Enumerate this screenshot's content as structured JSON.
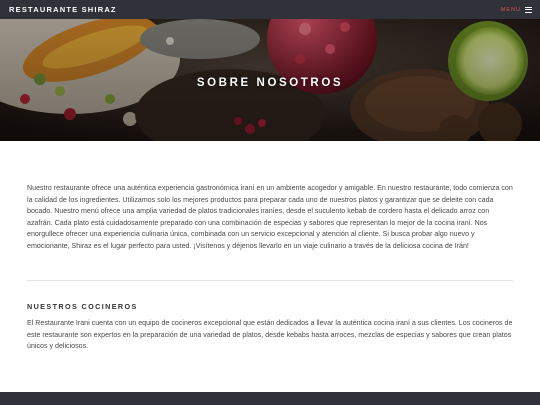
{
  "header": {
    "brand": "RESTAURANTE SHIRAZ",
    "menu_label": "MENU"
  },
  "hero": {
    "title": "SOBRE NOSOTROS"
  },
  "about": {
    "paragraph": "Nuestro restaurante ofrece una auténtica experiencia gastronómica iraní en un ambiente acogedor y amigable. En nuestro restaurante, todo comienza con la calidad de los ingredientes. Utilizamos solo los mejores productos para preparar cada uno de nuestros platos y garantizar que se deleite con cada bocado. Nuestro menú ofrece una amplia variedad de platos tradicionales iraníes, desde el suculento kebab de cordero hasta el delicado arroz con azafrán. Cada plato está cuidadosamente preparado con una combinación de especias y sabores que representan lo mejor de la cocina iraní. Nos enorgullece ofrecer una experiencia culinaria única, combinada con un servicio excepcional y atención al cliente. Si busca probar algo nuevo y emocionante, Shiraz es el lugar perfecto para usted. ¡Visítenos y déjenos llevarlo en un viaje culinario a través de la deliciosa cocina de Irán!"
  },
  "chefs": {
    "title": "NUESTROS COCINEROS",
    "paragraph": "El Restaurante Irani cuenta con un equipo de cocineros excepcional que están dedicados a llevar la auténtica cocina iraní a sus clientes. Los cocineros de este restaurante son expertos en la preparación de una variedad de platos, desde kebabs hasta arroces, mezclas de especias y sabores que crean platos únicos y deliciosos."
  },
  "colors": {
    "header_bg": "#2f3238",
    "menu_accent": "#e05050"
  },
  "icons": {
    "menu": "hamburger-icon"
  }
}
